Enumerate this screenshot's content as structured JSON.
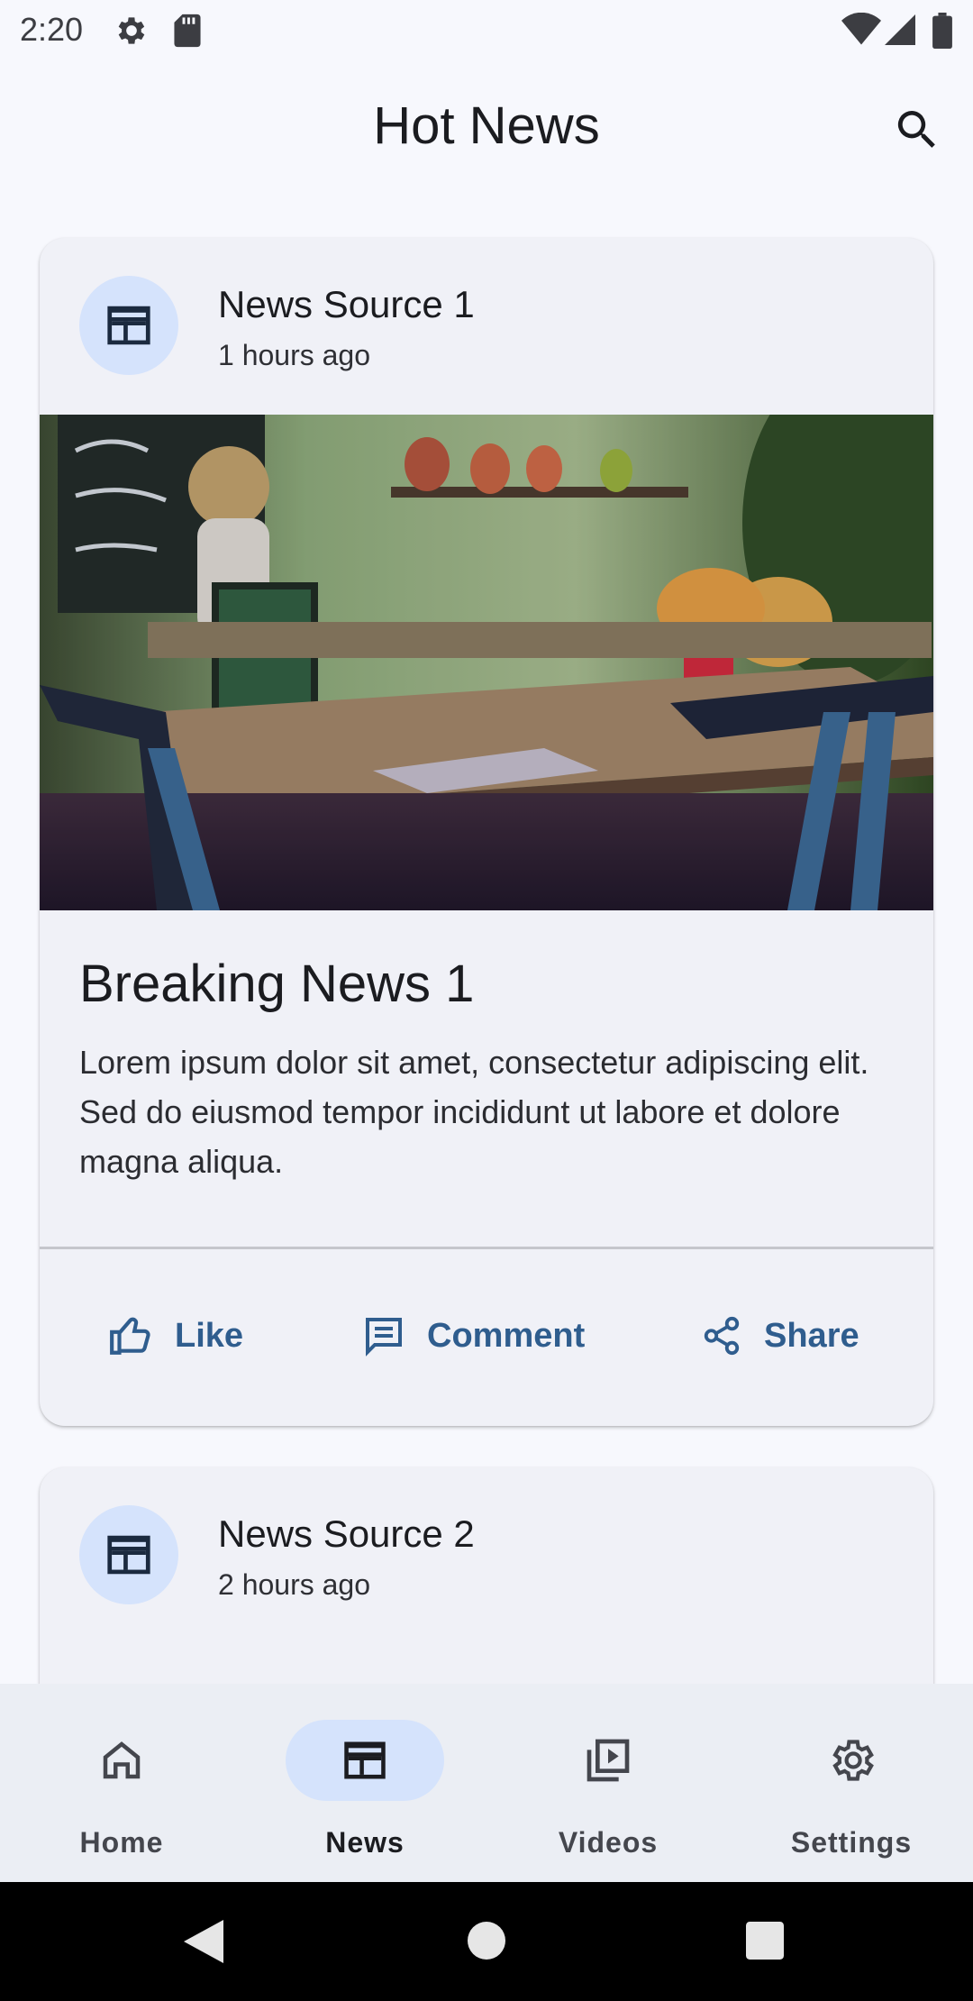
{
  "status_bar": {
    "time": "2:20",
    "icons": [
      "settings-icon",
      "sd-card-icon",
      "wifi-icon",
      "signal-icon",
      "battery-icon"
    ]
  },
  "app_bar": {
    "title": "Hot News",
    "search_icon": "search-icon"
  },
  "feed": {
    "cards": [
      {
        "source": "News Source 1",
        "time": "1 hours ago",
        "avatar_icon": "newspaper-icon",
        "headline": "Breaking News 1",
        "summary": "Lorem ipsum dolor sit amet, consectetur adipiscing elit. Sed do eiusmod tempor incididunt ut labore et dolore magna aliqua.",
        "image": "cafe-table-photo",
        "actions": [
          {
            "label": "Like",
            "icon": "thumb-up-icon"
          },
          {
            "label": "Comment",
            "icon": "comment-icon"
          },
          {
            "label": "Share",
            "icon": "share-icon"
          }
        ]
      },
      {
        "source": "News Source 2",
        "time": "2 hours ago",
        "avatar_icon": "newspaper-icon"
      }
    ]
  },
  "bottom_nav": {
    "items": [
      {
        "label": "Home",
        "icon": "home-icon",
        "active": false
      },
      {
        "label": "News",
        "icon": "newspaper-icon",
        "active": true
      },
      {
        "label": "Videos",
        "icon": "video-library-icon",
        "active": false
      },
      {
        "label": "Settings",
        "icon": "gear-icon",
        "active": false
      }
    ]
  },
  "colors": {
    "background": "#f7f8fd",
    "card": "#f0f1f7",
    "accent": "#2f5d8e",
    "active_pill": "#d5e3fc",
    "nav_bar": "#ebeef4"
  }
}
